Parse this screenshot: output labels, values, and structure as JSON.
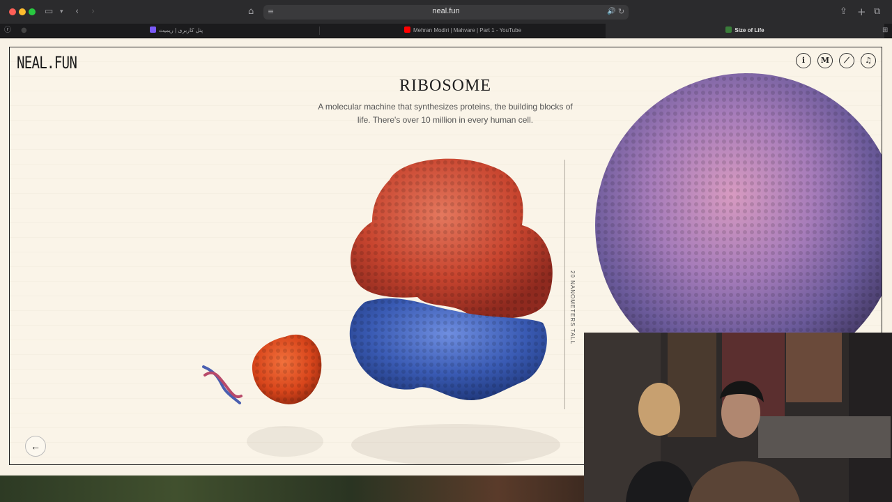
{
  "browser": {
    "url": "neal.fun",
    "tabs": [
      {
        "label": "پنل کاربری | ریمیت",
        "favicon_color": "#7a5af8"
      },
      {
        "label": "Mehran Modiri | Mahvare | Part 1 - YouTube",
        "favicon_color": "#ff0000"
      },
      {
        "label": "Size of Life",
        "favicon_color": "#3a7d3a",
        "active": true
      }
    ]
  },
  "page": {
    "logo": "NEAL.FUN",
    "title": "RIBOSOME",
    "description": "A molecular machine that synthesizes proteins, the building blocks of life. There's over 10 million in every human cell.",
    "measurement": "20 nanometers tall",
    "back_button": "←",
    "toolbar_icons": [
      "info-icon",
      "m-icon",
      "ruler-icon",
      "music-icon"
    ],
    "toolbar_glyphs": {
      "info": "i",
      "m": "M",
      "ruler": "⟋",
      "music": "♫"
    }
  },
  "colors": {
    "page_bg": "#f8f2e6",
    "ribosome_large": "#c9412e",
    "ribosome_small": "#3c63b8",
    "virus": "#b07bb0",
    "protein": "#e0481f",
    "dna": "#4a5fb0"
  }
}
